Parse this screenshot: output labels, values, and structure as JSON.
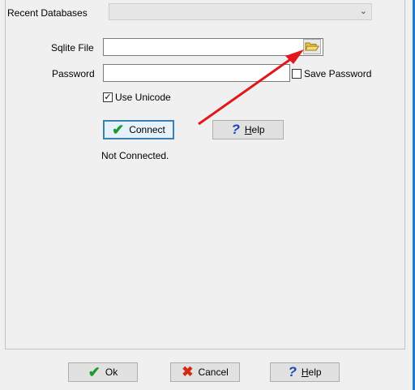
{
  "connection": {
    "recent_label": "Recent Databases",
    "recent_value": "",
    "file_label": "Sqlite File",
    "file_value": "",
    "password_label": "Password",
    "password_value": "",
    "save_password_label": "Save Password",
    "save_password_checked": false,
    "use_unicode_label": "Use Unicode",
    "use_unicode_checked": true,
    "connect_label": "Connect",
    "help_label": "Help",
    "status": "Not Connected."
  },
  "footer": {
    "ok_label": "Ok",
    "cancel_label": "Cancel",
    "help_label": "Help"
  },
  "icons": {
    "combo_arrow": "chevron-down-icon",
    "browse": "folder-open-icon",
    "connect": "checkmark-icon",
    "help": "question-mark-icon",
    "cancel": "x-icon",
    "annotation": "red-arrow"
  },
  "colors": {
    "arrow": "#e3161b",
    "checkmark": "#1d9a2c",
    "cancel_x": "#d42a14",
    "help_q": "#1a44b8",
    "window_edge": "#1f7ad6"
  }
}
